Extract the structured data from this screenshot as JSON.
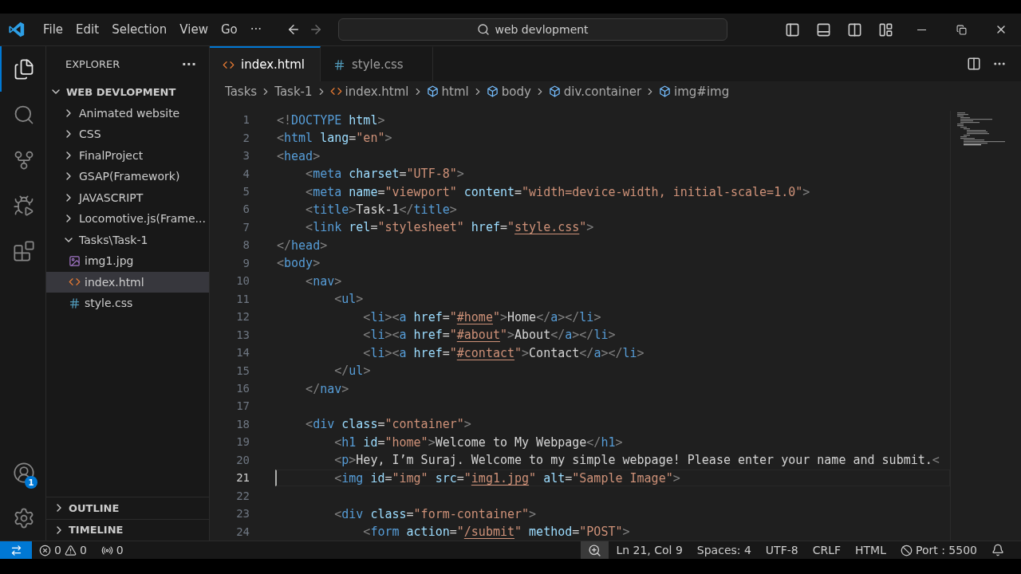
{
  "menu": [
    "File",
    "Edit",
    "Selection",
    "View",
    "Go",
    "···"
  ],
  "command_search": {
    "value": "web devlopment"
  },
  "activity_bar": [
    {
      "kind": "explorer",
      "selected": true
    },
    {
      "kind": "search",
      "selected": false
    },
    {
      "kind": "source-control",
      "selected": false
    },
    {
      "kind": "run-debug",
      "selected": false
    },
    {
      "kind": "extensions",
      "selected": false
    }
  ],
  "account": {
    "badge": "1"
  },
  "sidebar": {
    "title": "EXPLORER",
    "more": "···",
    "root": "WEB DEVLOPMENT",
    "items": [
      {
        "label": "Animated website",
        "kind": "folder",
        "expanded": false,
        "selected": false
      },
      {
        "label": "CSS",
        "kind": "folder",
        "expanded": false,
        "selected": false
      },
      {
        "label": "FinalProject",
        "kind": "folder",
        "expanded": false,
        "selected": false
      },
      {
        "label": "GSAP(Framework)",
        "kind": "folder",
        "expanded": false,
        "selected": false
      },
      {
        "label": "JAVASCRIPT",
        "kind": "folder",
        "expanded": false,
        "selected": false
      },
      {
        "label": "Locomotive.js(Frame...",
        "kind": "folder",
        "expanded": false,
        "selected": false
      },
      {
        "label": "Tasks\\Task-1",
        "kind": "folder",
        "expanded": true,
        "selected": false,
        "children": [
          {
            "label": "img1.jpg",
            "kind": "image",
            "selected": false
          },
          {
            "label": "index.html",
            "kind": "html",
            "selected": true
          },
          {
            "label": "style.css",
            "kind": "css",
            "selected": false
          }
        ]
      }
    ],
    "panels": [
      {
        "label": "OUTLINE",
        "expanded": false
      },
      {
        "label": "TIMELINE",
        "expanded": false
      }
    ]
  },
  "tabs": [
    {
      "label": "index.html",
      "kind": "html",
      "selected": true
    },
    {
      "label": "style.css",
      "kind": "css",
      "selected": false
    }
  ],
  "breadcrumbs": [
    {
      "label": "Tasks",
      "kind": "folder"
    },
    {
      "label": "Task-1",
      "kind": "folder"
    },
    {
      "label": "index.html",
      "kind": "html"
    },
    {
      "label": "html",
      "kind": "element"
    },
    {
      "label": "body",
      "kind": "element"
    },
    {
      "label": "div.container",
      "kind": "element"
    },
    {
      "label": "img#img",
      "kind": "element"
    }
  ],
  "code_lines": [
    {
      "number": "1",
      "current": false,
      "tokens": [
        {
          "kind": "p",
          "text": "<!"
        },
        {
          "kind": "tag",
          "text": "DOCTYPE"
        },
        {
          "kind": "attr",
          "text": " html"
        },
        {
          "kind": "p",
          "text": ">"
        }
      ]
    },
    {
      "number": "2",
      "current": false,
      "tokens": [
        {
          "kind": "p",
          "text": "<"
        },
        {
          "kind": "tag",
          "text": "html"
        },
        {
          "kind": "attr",
          "text": " lang"
        },
        {
          "kind": "t",
          "text": "="
        },
        {
          "kind": "str",
          "text": "\"en\""
        },
        {
          "kind": "p",
          "text": ">"
        }
      ]
    },
    {
      "number": "3",
      "current": false,
      "tokens": [
        {
          "kind": "p",
          "text": "<"
        },
        {
          "kind": "tag",
          "text": "head"
        },
        {
          "kind": "p",
          "text": ">"
        }
      ]
    },
    {
      "number": "4",
      "current": false,
      "tokens": [
        {
          "kind": "p",
          "text": "    <"
        },
        {
          "kind": "tag",
          "text": "meta"
        },
        {
          "kind": "attr",
          "text": " charset"
        },
        {
          "kind": "t",
          "text": "="
        },
        {
          "kind": "str",
          "text": "\"UTF-8\""
        },
        {
          "kind": "p",
          "text": ">"
        }
      ]
    },
    {
      "number": "5",
      "current": false,
      "tokens": [
        {
          "kind": "p",
          "text": "    <"
        },
        {
          "kind": "tag",
          "text": "meta"
        },
        {
          "kind": "attr",
          "text": " name"
        },
        {
          "kind": "t",
          "text": "="
        },
        {
          "kind": "str",
          "text": "\"viewport\""
        },
        {
          "kind": "attr",
          "text": " content"
        },
        {
          "kind": "t",
          "text": "="
        },
        {
          "kind": "str",
          "text": "\"width=device-width, initial-scale=1.0\""
        },
        {
          "kind": "p",
          "text": ">"
        }
      ]
    },
    {
      "number": "6",
      "current": false,
      "tokens": [
        {
          "kind": "p",
          "text": "    <"
        },
        {
          "kind": "tag",
          "text": "title"
        },
        {
          "kind": "p",
          "text": ">"
        },
        {
          "kind": "t",
          "text": "Task-1"
        },
        {
          "kind": "p",
          "text": "</"
        },
        {
          "kind": "tag",
          "text": "title"
        },
        {
          "kind": "p",
          "text": ">"
        }
      ]
    },
    {
      "number": "7",
      "current": false,
      "tokens": [
        {
          "kind": "p",
          "text": "    <"
        },
        {
          "kind": "tag",
          "text": "link"
        },
        {
          "kind": "attr",
          "text": " rel"
        },
        {
          "kind": "t",
          "text": "="
        },
        {
          "kind": "str",
          "text": "\"stylesheet\""
        },
        {
          "kind": "attr",
          "text": " href"
        },
        {
          "kind": "t",
          "text": "="
        },
        {
          "kind": "str",
          "text": "\""
        },
        {
          "kind": "link",
          "text": "style.css"
        },
        {
          "kind": "str",
          "text": "\""
        },
        {
          "kind": "p",
          "text": ">"
        }
      ]
    },
    {
      "number": "8",
      "current": false,
      "tokens": [
        {
          "kind": "p",
          "text": "</"
        },
        {
          "kind": "tag",
          "text": "head"
        },
        {
          "kind": "p",
          "text": ">"
        }
      ]
    },
    {
      "number": "9",
      "current": false,
      "tokens": [
        {
          "kind": "p",
          "text": "<"
        },
        {
          "kind": "tag",
          "text": "body"
        },
        {
          "kind": "p",
          "text": ">"
        }
      ]
    },
    {
      "number": "10",
      "current": false,
      "tokens": [
        {
          "kind": "p",
          "text": "    <"
        },
        {
          "kind": "tag",
          "text": "nav"
        },
        {
          "kind": "p",
          "text": ">"
        }
      ]
    },
    {
      "number": "11",
      "current": false,
      "tokens": [
        {
          "kind": "p",
          "text": "        <"
        },
        {
          "kind": "tag",
          "text": "ul"
        },
        {
          "kind": "p",
          "text": ">"
        }
      ]
    },
    {
      "number": "12",
      "current": false,
      "tokens": [
        {
          "kind": "p",
          "text": "            <"
        },
        {
          "kind": "tag",
          "text": "li"
        },
        {
          "kind": "p",
          "text": "><"
        },
        {
          "kind": "tag",
          "text": "a"
        },
        {
          "kind": "attr",
          "text": " href"
        },
        {
          "kind": "t",
          "text": "="
        },
        {
          "kind": "str",
          "text": "\""
        },
        {
          "kind": "link",
          "text": "#home"
        },
        {
          "kind": "str",
          "text": "\""
        },
        {
          "kind": "p",
          "text": ">"
        },
        {
          "kind": "t",
          "text": "Home"
        },
        {
          "kind": "p",
          "text": "</"
        },
        {
          "kind": "tag",
          "text": "a"
        },
        {
          "kind": "p",
          "text": "></"
        },
        {
          "kind": "tag",
          "text": "li"
        },
        {
          "kind": "p",
          "text": ">"
        }
      ]
    },
    {
      "number": "13",
      "current": false,
      "tokens": [
        {
          "kind": "p",
          "text": "            <"
        },
        {
          "kind": "tag",
          "text": "li"
        },
        {
          "kind": "p",
          "text": "><"
        },
        {
          "kind": "tag",
          "text": "a"
        },
        {
          "kind": "attr",
          "text": " href"
        },
        {
          "kind": "t",
          "text": "="
        },
        {
          "kind": "str",
          "text": "\""
        },
        {
          "kind": "link",
          "text": "#about"
        },
        {
          "kind": "str",
          "text": "\""
        },
        {
          "kind": "p",
          "text": ">"
        },
        {
          "kind": "t",
          "text": "About"
        },
        {
          "kind": "p",
          "text": "</"
        },
        {
          "kind": "tag",
          "text": "a"
        },
        {
          "kind": "p",
          "text": "></"
        },
        {
          "kind": "tag",
          "text": "li"
        },
        {
          "kind": "p",
          "text": ">"
        }
      ]
    },
    {
      "number": "14",
      "current": false,
      "tokens": [
        {
          "kind": "p",
          "text": "            <"
        },
        {
          "kind": "tag",
          "text": "li"
        },
        {
          "kind": "p",
          "text": "><"
        },
        {
          "kind": "tag",
          "text": "a"
        },
        {
          "kind": "attr",
          "text": " href"
        },
        {
          "kind": "t",
          "text": "="
        },
        {
          "kind": "str",
          "text": "\""
        },
        {
          "kind": "link",
          "text": "#contact"
        },
        {
          "kind": "str",
          "text": "\""
        },
        {
          "kind": "p",
          "text": ">"
        },
        {
          "kind": "t",
          "text": "Contact"
        },
        {
          "kind": "p",
          "text": "</"
        },
        {
          "kind": "tag",
          "text": "a"
        },
        {
          "kind": "p",
          "text": "></"
        },
        {
          "kind": "tag",
          "text": "li"
        },
        {
          "kind": "p",
          "text": ">"
        }
      ]
    },
    {
      "number": "15",
      "current": false,
      "tokens": [
        {
          "kind": "p",
          "text": "        </"
        },
        {
          "kind": "tag",
          "text": "ul"
        },
        {
          "kind": "p",
          "text": ">"
        }
      ]
    },
    {
      "number": "16",
      "current": false,
      "tokens": [
        {
          "kind": "p",
          "text": "    </"
        },
        {
          "kind": "tag",
          "text": "nav"
        },
        {
          "kind": "p",
          "text": ">"
        }
      ]
    },
    {
      "number": "17",
      "current": false
    },
    {
      "number": "18",
      "current": false,
      "tokens": [
        {
          "kind": "p",
          "text": "    <"
        },
        {
          "kind": "tag",
          "text": "div"
        },
        {
          "kind": "attr",
          "text": " class"
        },
        {
          "kind": "t",
          "text": "="
        },
        {
          "kind": "str",
          "text": "\"container\""
        },
        {
          "kind": "p",
          "text": ">"
        }
      ]
    },
    {
      "number": "19",
      "current": false,
      "tokens": [
        {
          "kind": "p",
          "text": "        <"
        },
        {
          "kind": "tag",
          "text": "h1"
        },
        {
          "kind": "attr",
          "text": " id"
        },
        {
          "kind": "t",
          "text": "="
        },
        {
          "kind": "str",
          "text": "\"home\""
        },
        {
          "kind": "p",
          "text": ">"
        },
        {
          "kind": "t",
          "text": "Welcome to My Webpage"
        },
        {
          "kind": "p",
          "text": "</"
        },
        {
          "kind": "tag",
          "text": "h1"
        },
        {
          "kind": "p",
          "text": ">"
        }
      ]
    },
    {
      "number": "20",
      "current": false,
      "tokens": [
        {
          "kind": "p",
          "text": "        <"
        },
        {
          "kind": "tag",
          "text": "p"
        },
        {
          "kind": "p",
          "text": ">"
        },
        {
          "kind": "t",
          "text": "Hey, I’m Suraj. Welcome to my simple webpage! Please enter your name and submit."
        },
        {
          "kind": "p",
          "text": "<"
        }
      ]
    },
    {
      "number": "21",
      "current": true,
      "tokens": [
        {
          "kind": "p",
          "text": "        <"
        },
        {
          "kind": "tag",
          "text": "img"
        },
        {
          "kind": "attr",
          "text": " id"
        },
        {
          "kind": "t",
          "text": "="
        },
        {
          "kind": "str",
          "text": "\"img\""
        },
        {
          "kind": "attr",
          "text": " src"
        },
        {
          "kind": "t",
          "text": "="
        },
        {
          "kind": "str",
          "text": "\""
        },
        {
          "kind": "link",
          "text": "img1.jpg"
        },
        {
          "kind": "str",
          "text": "\""
        },
        {
          "kind": "attr",
          "text": " alt"
        },
        {
          "kind": "t",
          "text": "="
        },
        {
          "kind": "str",
          "text": "\"Sample Image\""
        },
        {
          "kind": "p",
          "text": ">"
        }
      ]
    },
    {
      "number": "22",
      "current": false
    },
    {
      "number": "23",
      "current": false,
      "tokens": [
        {
          "kind": "p",
          "text": "        <"
        },
        {
          "kind": "tag",
          "text": "div"
        },
        {
          "kind": "attr",
          "text": " class"
        },
        {
          "kind": "t",
          "text": "="
        },
        {
          "kind": "str",
          "text": "\"form-container\""
        },
        {
          "kind": "p",
          "text": ">"
        }
      ]
    },
    {
      "number": "24",
      "current": false,
      "tokens": [
        {
          "kind": "p",
          "text": "            <"
        },
        {
          "kind": "tag",
          "text": "form"
        },
        {
          "kind": "attr",
          "text": " action"
        },
        {
          "kind": "t",
          "text": "="
        },
        {
          "kind": "str",
          "text": "\""
        },
        {
          "kind": "link",
          "text": "/submit"
        },
        {
          "kind": "str",
          "text": "\""
        },
        {
          "kind": "attr",
          "text": " method"
        },
        {
          "kind": "t",
          "text": "="
        },
        {
          "kind": "str",
          "text": "\"POST\""
        },
        {
          "kind": "p",
          "text": ">"
        }
      ]
    }
  ],
  "status_bar": {
    "errors": "0",
    "warnings": "0",
    "ports": "0",
    "right": [
      {
        "kind": "zoom"
      },
      {
        "kind": "text",
        "label": "Ln 21, Col 9"
      },
      {
        "kind": "text",
        "label": "Spaces: 4"
      },
      {
        "kind": "text",
        "label": "UTF-8"
      },
      {
        "kind": "text",
        "label": "CRLF"
      },
      {
        "kind": "text",
        "label": "HTML"
      },
      {
        "kind": "port",
        "label": "Port : 5500"
      },
      {
        "kind": "bell"
      }
    ]
  }
}
